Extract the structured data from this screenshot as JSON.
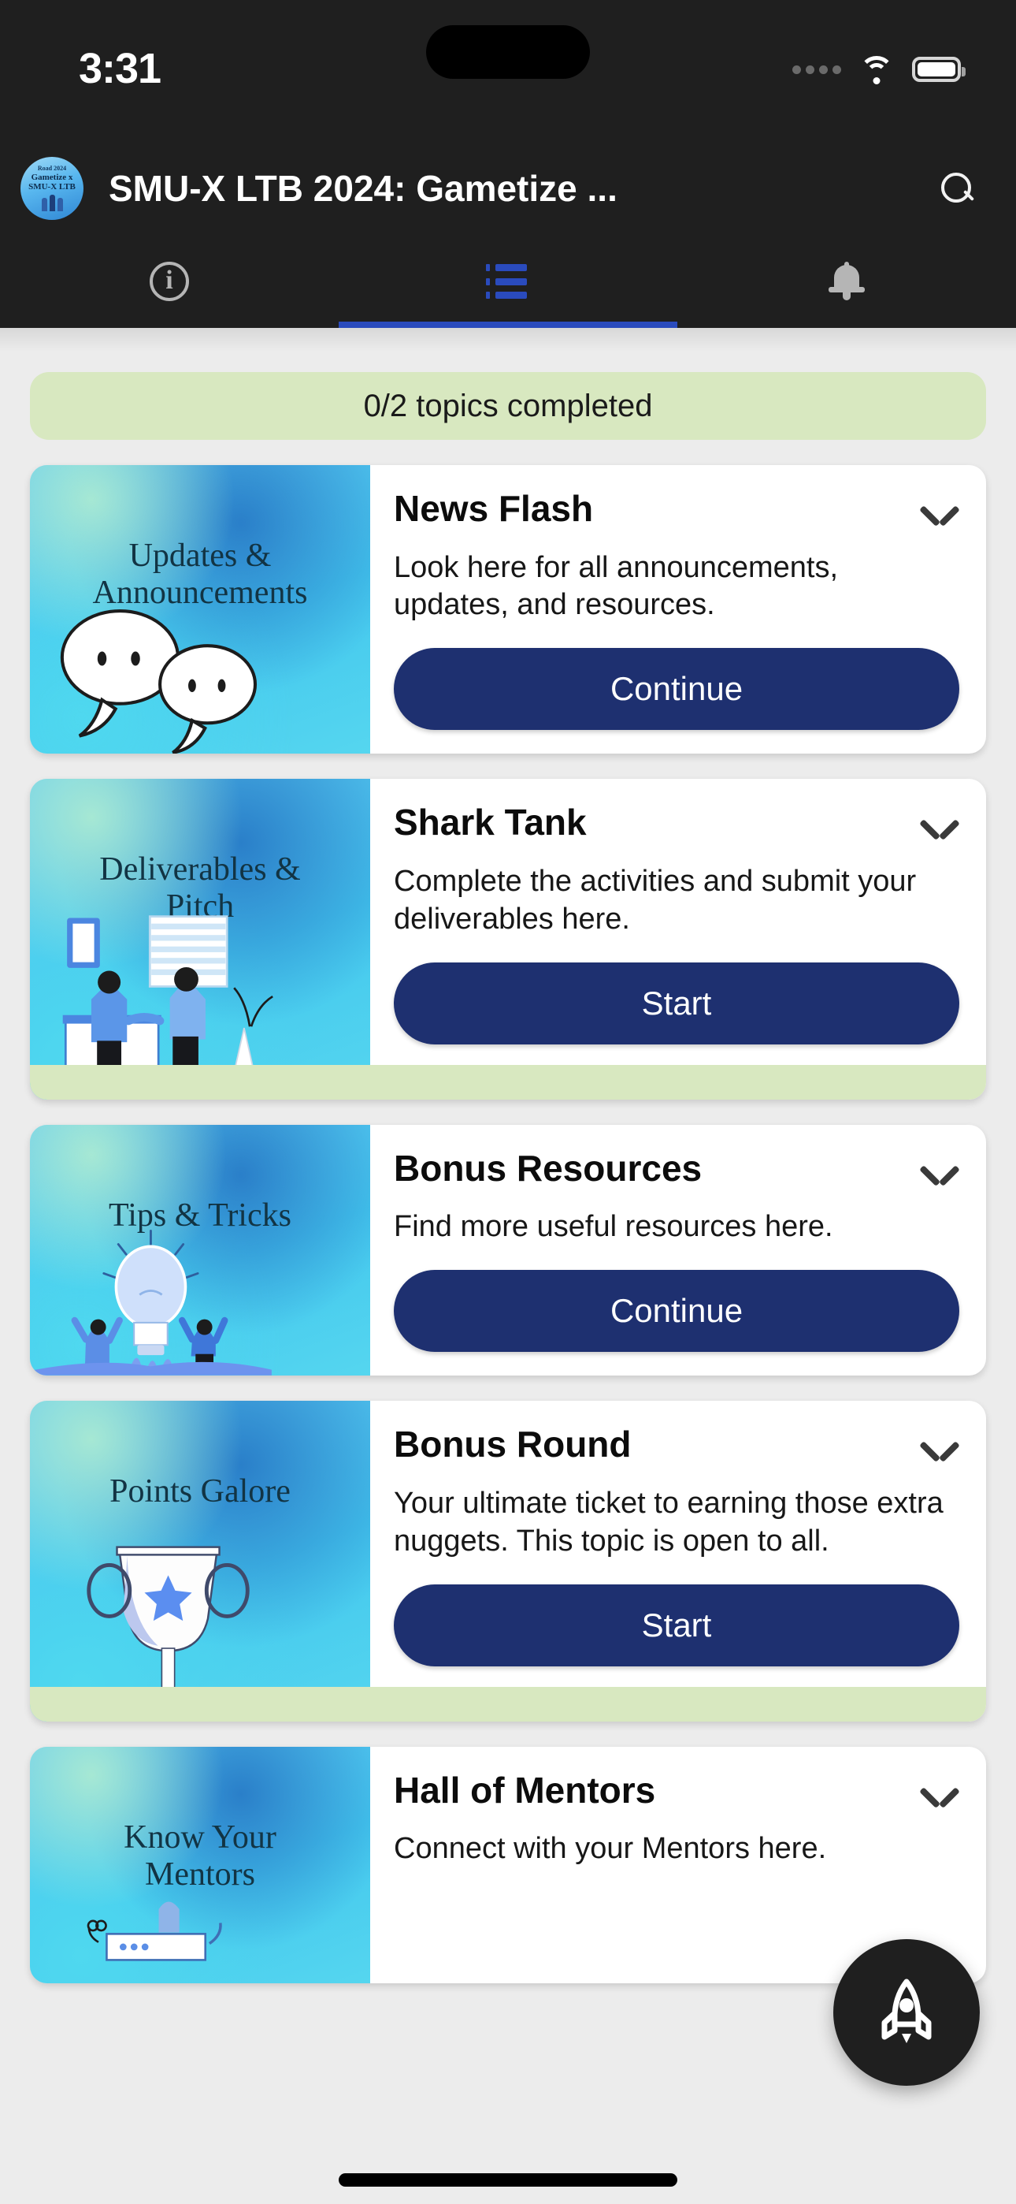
{
  "status_bar": {
    "time": "3:31",
    "signal_icon": "signal-dots-icon",
    "wifi_icon": "wifi-icon",
    "battery_icon": "battery-icon"
  },
  "app_bar": {
    "logo_top": "Road 2024",
    "logo_line1": "Gametize x",
    "logo_line2": "SMU-X LTB",
    "title": "SMU-X LTB 2024: Gametize ...",
    "search_icon": "search-icon"
  },
  "tabs": [
    {
      "name": "info",
      "icon": "info-circle-icon",
      "active": false
    },
    {
      "name": "topics",
      "icon": "list-icon",
      "active": true
    },
    {
      "name": "notifications",
      "icon": "bell-icon",
      "active": false
    }
  ],
  "progress": {
    "label": "0/2 topics completed",
    "color": "#d8e8c0"
  },
  "accent_colors": {
    "button_navy": "#1e3070",
    "tab_active": "#2a4bbd",
    "progress_green": "#d8e8c0",
    "app_bar_dark": "#1f1f1f"
  },
  "topics": [
    {
      "thumb_title": "Updates &\nAnnouncements",
      "thumb_art": "speech-bubbles",
      "title": "News Flash",
      "description": "Look here for all announcements, updates, and resources.",
      "button": "Continue",
      "chevron_icon": "chevron-down-icon",
      "has_footer": false
    },
    {
      "thumb_title": "Deliverables &\nPitch",
      "thumb_art": "handshake-office",
      "title": "Shark Tank",
      "description": "Complete the activities and submit your deliverables here.",
      "button": "Start",
      "chevron_icon": "chevron-down-icon",
      "has_footer": true
    },
    {
      "thumb_title": "Tips & Tricks",
      "thumb_art": "lightbulb-people",
      "title": "Bonus Resources",
      "description": "Find more useful resources here.",
      "button": "Continue",
      "chevron_icon": "chevron-down-icon",
      "has_footer": false
    },
    {
      "thumb_title": "Points Galore",
      "thumb_art": "trophy-star",
      "title": "Bonus Round",
      "description": "Your ultimate ticket to earning those extra nuggets. This topic is open to all.",
      "button": "Start",
      "chevron_icon": "chevron-down-icon",
      "has_footer": true
    },
    {
      "thumb_title": "Know Your\nMentors",
      "thumb_art": "mentors-desk",
      "title": "Hall of Mentors",
      "description": "Connect with your Mentors here.",
      "button": "",
      "chevron_icon": "chevron-down-icon",
      "has_footer": false
    }
  ],
  "fab": {
    "icon": "rocket-icon"
  }
}
